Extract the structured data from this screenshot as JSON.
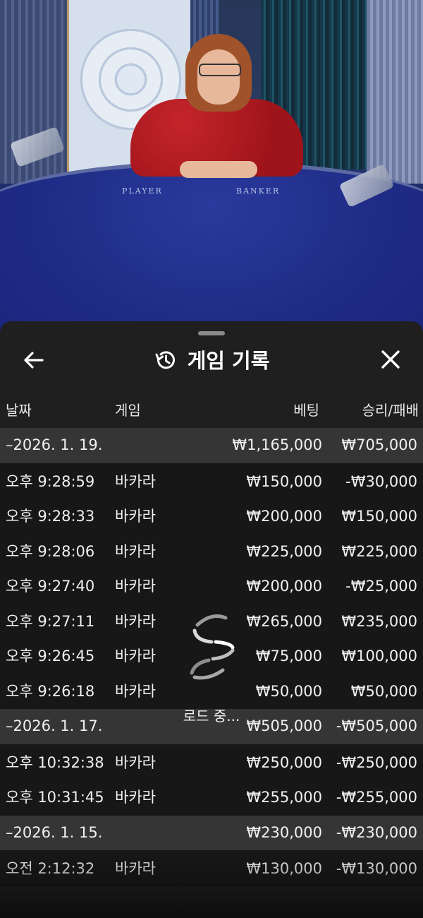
{
  "video": {
    "player_label": "PLAYER",
    "banker_label": "BANKER"
  },
  "header": {
    "title": "게임 기록",
    "back_icon": "arrow-left-icon",
    "history_icon": "history-clock-icon",
    "close_icon": "close-icon"
  },
  "columns": {
    "date": "날짜",
    "game": "게임",
    "bet": "베팅",
    "result": "승리/패배"
  },
  "groups": [
    {
      "date": "–2026. 1. 19.",
      "total_bet": "₩1,165,000",
      "total_result": "₩705,000",
      "rows": [
        {
          "time": "오후 9:28:59",
          "game": "바카라",
          "bet": "₩150,000",
          "result": "-₩30,000"
        },
        {
          "time": "오후 9:28:33",
          "game": "바카라",
          "bet": "₩200,000",
          "result": "₩150,000"
        },
        {
          "time": "오후 9:28:06",
          "game": "바카라",
          "bet": "₩225,000",
          "result": "₩225,000"
        },
        {
          "time": "오후 9:27:40",
          "game": "바카라",
          "bet": "₩200,000",
          "result": "-₩25,000"
        },
        {
          "time": "오후 9:27:11",
          "game": "바카라",
          "bet": "₩265,000",
          "result": "₩235,000"
        },
        {
          "time": "오후 9:26:45",
          "game": "바카라",
          "bet": "₩75,000",
          "result": "₩100,000"
        },
        {
          "time": "오후 9:26:18",
          "game": "바카라",
          "bet": "₩50,000",
          "result": "₩50,000"
        }
      ]
    },
    {
      "date": "–2026. 1. 17.",
      "total_bet": "₩505,000",
      "total_result": "-₩505,000",
      "rows": [
        {
          "time": "오후 10:32:38",
          "game": "바카라",
          "bet": "₩250,000",
          "result": "-₩250,000"
        },
        {
          "time": "오후 10:31:45",
          "game": "바카라",
          "bet": "₩255,000",
          "result": "-₩255,000"
        }
      ]
    },
    {
      "date": "–2026. 1. 15.",
      "total_bet": "₩230,000",
      "total_result": "-₩230,000",
      "rows": [
        {
          "time": "오전 2:12:32",
          "game": "바카라",
          "bet": "₩130,000",
          "result": "-₩130,000"
        }
      ]
    }
  ],
  "loader": {
    "text": "로드 중...",
    "icon": "loading-spinner-icon"
  }
}
